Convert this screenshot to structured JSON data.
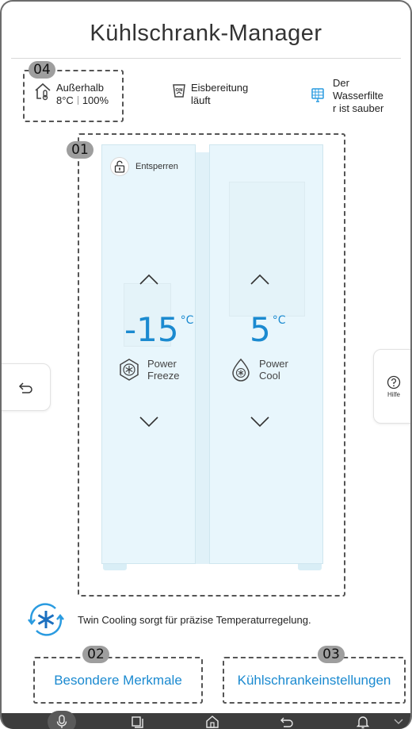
{
  "header": {
    "title": "Kühlschrank-Manager"
  },
  "badges": {
    "b01": "01",
    "b02": "02",
    "b03": "03",
    "b04": "04"
  },
  "status": {
    "outside": {
      "label": "Außerhalb",
      "temp": "8°C",
      "humidity": "100%",
      "icon": "house-thermometer-icon"
    },
    "ice": {
      "line1": "Eisbereitung",
      "line2": "läuft",
      "icon": "ice-maker-on-icon"
    },
    "filter": {
      "line1": "Der",
      "line2": "Wasserfilte",
      "line3": "r ist sauber",
      "icon": "water-filter-icon"
    }
  },
  "freezer": {
    "lock_label": "Entsperren",
    "temperature": "-15",
    "unit": "°C",
    "mode_line1": "Power",
    "mode_line2": "Freeze"
  },
  "fridge": {
    "temperature": "5",
    "unit": "°C",
    "mode_line1": "Power",
    "mode_line2": "Cool"
  },
  "side": {
    "help_label": "Hilfe"
  },
  "twin_cooling": {
    "text": "Twin Cooling sorgt für präzise Temperaturregelung."
  },
  "actions": {
    "features": "Besondere Merkmale",
    "settings": "Kühlschrankeinstellungen"
  },
  "colors": {
    "accent": "#1b8ad0",
    "door": "#e8f6fc",
    "navbar": "#3d3d3d"
  },
  "navbar": {
    "icons": [
      "microphone-icon",
      "recent-apps-icon",
      "home-icon",
      "back-icon",
      "notification-icon",
      "chevron-down-icon"
    ]
  }
}
